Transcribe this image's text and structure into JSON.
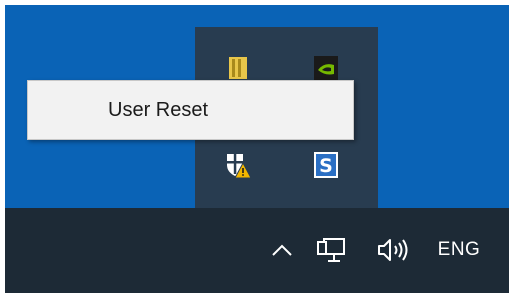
{
  "context_menu": {
    "items": [
      {
        "label": "User Reset"
      }
    ]
  },
  "tray_overflow": {
    "icons": [
      "app-yellow-icon",
      "nvidia-icon",
      "windows-security-warning-icon",
      "sync-s-icon"
    ]
  },
  "taskbar": {
    "language": "ENG",
    "icons": [
      "show-hidden-icons-chevron-icon",
      "network-icon",
      "volume-icon"
    ]
  },
  "colors": {
    "desktop": "#0a63b6",
    "taskbar": "#1d2a36",
    "flyout": "#283c50",
    "menu": "#f2f2f2",
    "warning": "#f2b600"
  }
}
